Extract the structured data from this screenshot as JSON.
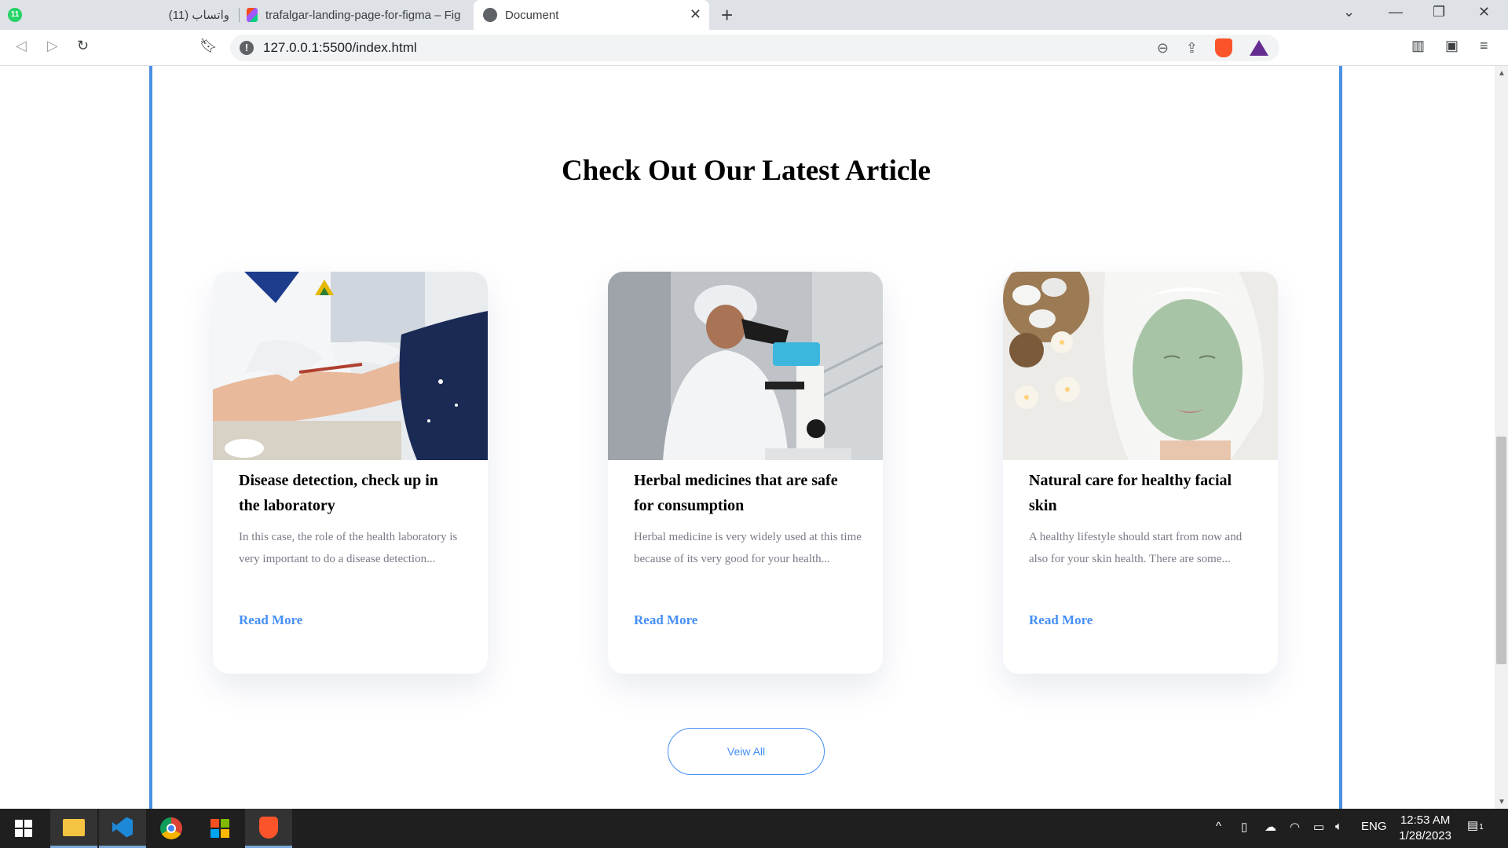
{
  "browser": {
    "tabs": [
      {
        "label": "(11) واتساب",
        "badge": "11"
      },
      {
        "label": "trafalgar-landing-page-for-figma – Fig"
      },
      {
        "label": "Document"
      }
    ],
    "url": "127.0.0.1:5500/index.html"
  },
  "page": {
    "section_title": "Check Out Our Latest Article",
    "articles": [
      {
        "title": "Disease detection, check up in the laboratory",
        "description": "In this case, the role of the health laboratory is very important to do a disease detection...",
        "link": "Read More"
      },
      {
        "title": "Herbal medicines that are safe for consumption",
        "description": "Herbal medicine is very widely used at this time because of its very good for your health...",
        "link": "Read More"
      },
      {
        "title": "Natural care for healthy facial skin",
        "description": "A healthy lifestyle should start from now and also for your skin health. There are some...",
        "link": "Read More"
      }
    ],
    "view_all": "Veiw All"
  },
  "taskbar": {
    "language": "ENG",
    "time": "12:53 AM",
    "date": "1/28/2023",
    "notification_count": "1"
  },
  "colors": {
    "accent": "#458ff6",
    "frame": "#4a90e2",
    "heading": "#000000",
    "body_text": "#7d7987"
  }
}
